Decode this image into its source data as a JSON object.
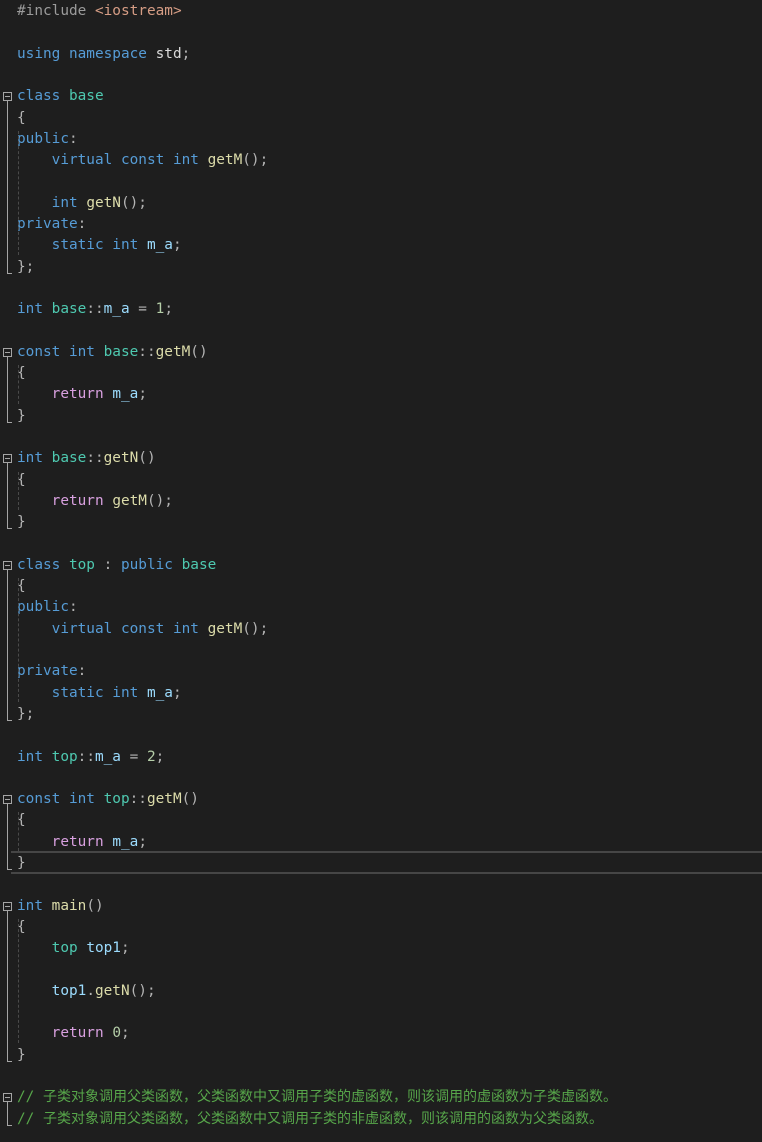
{
  "editor": {
    "lines": [
      [
        [
          "pp",
          "#include "
        ],
        [
          "str",
          "<iostream>"
        ]
      ],
      [],
      [
        [
          "kw",
          "using namespace "
        ],
        [
          "gl",
          "std"
        ],
        [
          "op",
          ";"
        ]
      ],
      [],
      [
        [
          "kw",
          "class "
        ],
        [
          "ty",
          "base"
        ]
      ],
      [
        [
          "op",
          "{"
        ]
      ],
      [
        [
          "kw",
          "public"
        ],
        [
          "op",
          ":"
        ]
      ],
      [
        [
          "t",
          "    "
        ],
        [
          "kw",
          "virtual const int "
        ],
        [
          "fn",
          "getM"
        ],
        [
          "op",
          "();"
        ]
      ],
      [],
      [
        [
          "t",
          "    "
        ],
        [
          "kw",
          "int "
        ],
        [
          "fn",
          "getN"
        ],
        [
          "op",
          "();"
        ]
      ],
      [
        [
          "kw",
          "private"
        ],
        [
          "op",
          ":"
        ]
      ],
      [
        [
          "t",
          "    "
        ],
        [
          "kw",
          "static int "
        ],
        [
          "vr",
          "m_a"
        ],
        [
          "op",
          ";"
        ]
      ],
      [
        [
          "op",
          "};"
        ]
      ],
      [],
      [
        [
          "kw",
          "int "
        ],
        [
          "ty",
          "base"
        ],
        [
          "op",
          "::"
        ],
        [
          "vr",
          "m_a"
        ],
        [
          "op",
          " = "
        ],
        [
          "num",
          "1"
        ],
        [
          "op",
          ";"
        ]
      ],
      [],
      [
        [
          "kw",
          "const int "
        ],
        [
          "ty",
          "base"
        ],
        [
          "op",
          "::"
        ],
        [
          "fn",
          "getM"
        ],
        [
          "op",
          "()"
        ]
      ],
      [
        [
          "op",
          "{"
        ]
      ],
      [
        [
          "t",
          "    "
        ],
        [
          "ctl",
          "return "
        ],
        [
          "vr",
          "m_a"
        ],
        [
          "op",
          ";"
        ]
      ],
      [
        [
          "op",
          "}"
        ]
      ],
      [],
      [
        [
          "kw",
          "int "
        ],
        [
          "ty",
          "base"
        ],
        [
          "op",
          "::"
        ],
        [
          "fn",
          "getN"
        ],
        [
          "op",
          "()"
        ]
      ],
      [
        [
          "op",
          "{"
        ]
      ],
      [
        [
          "t",
          "    "
        ],
        [
          "ctl",
          "return "
        ],
        [
          "fn",
          "getM"
        ],
        [
          "op",
          "();"
        ]
      ],
      [
        [
          "op",
          "}"
        ]
      ],
      [],
      [
        [
          "kw",
          "class "
        ],
        [
          "ty",
          "top"
        ],
        [
          "op",
          " : "
        ],
        [
          "kw",
          "public "
        ],
        [
          "ty",
          "base"
        ]
      ],
      [
        [
          "op",
          "{"
        ]
      ],
      [
        [
          "kw",
          "public"
        ],
        [
          "op",
          ":"
        ]
      ],
      [
        [
          "t",
          "    "
        ],
        [
          "kw",
          "virtual const int "
        ],
        [
          "fn",
          "getM"
        ],
        [
          "op",
          "();"
        ]
      ],
      [],
      [
        [
          "kw",
          "private"
        ],
        [
          "op",
          ":"
        ]
      ],
      [
        [
          "t",
          "    "
        ],
        [
          "kw",
          "static int "
        ],
        [
          "vr",
          "m_a"
        ],
        [
          "op",
          ";"
        ]
      ],
      [
        [
          "op",
          "};"
        ]
      ],
      [],
      [
        [
          "kw",
          "int "
        ],
        [
          "ty",
          "top"
        ],
        [
          "op",
          "::"
        ],
        [
          "vr",
          "m_a"
        ],
        [
          "op",
          " = "
        ],
        [
          "num",
          "2"
        ],
        [
          "op",
          ";"
        ]
      ],
      [],
      [
        [
          "kw",
          "const int "
        ],
        [
          "ty",
          "top"
        ],
        [
          "op",
          "::"
        ],
        [
          "fn",
          "getM"
        ],
        [
          "op",
          "()"
        ]
      ],
      [
        [
          "op",
          "{"
        ]
      ],
      [
        [
          "t",
          "    "
        ],
        [
          "ctl",
          "return "
        ],
        [
          "vr",
          "m_a"
        ],
        [
          "op",
          ";"
        ]
      ],
      [
        [
          "op",
          "}"
        ]
      ],
      [],
      [
        [
          "kw",
          "int "
        ],
        [
          "fn",
          "main"
        ],
        [
          "op",
          "()"
        ]
      ],
      [
        [
          "op",
          "{"
        ]
      ],
      [
        [
          "t",
          "    "
        ],
        [
          "ty",
          "top "
        ],
        [
          "vr",
          "top1"
        ],
        [
          "op",
          ";"
        ]
      ],
      [],
      [
        [
          "t",
          "    "
        ],
        [
          "vr",
          "top1"
        ],
        [
          "op",
          "."
        ],
        [
          "fn",
          "getN"
        ],
        [
          "op",
          "();"
        ]
      ],
      [],
      [
        [
          "t",
          "    "
        ],
        [
          "ctl",
          "return "
        ],
        [
          "num",
          "0"
        ],
        [
          "op",
          ";"
        ]
      ],
      [
        [
          "op",
          "}"
        ]
      ],
      [],
      [
        [
          "cm",
          "// "
        ],
        [
          "cm cjk",
          "子类对象调用父类函数，父类函数中又调用子类的虚函数，则该调用的虚函数为子类虚函数。"
        ]
      ],
      [
        [
          "cm",
          "// "
        ],
        [
          "cm cjk",
          "子类对象调用父类函数，父类函数中又调用子类的非虚函数，则该调用的函数为父类函数。"
        ]
      ]
    ]
  }
}
